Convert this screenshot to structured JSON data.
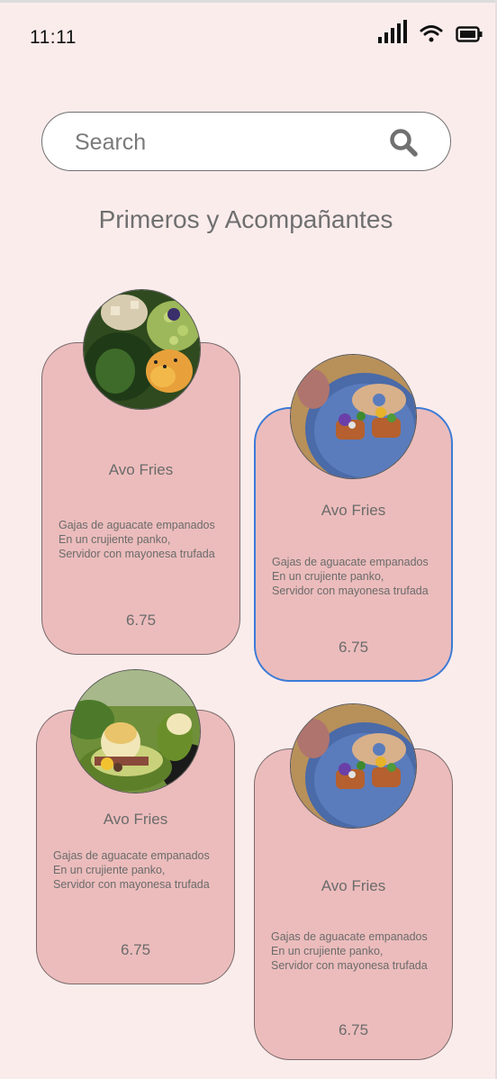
{
  "status": {
    "time": "11:11"
  },
  "search": {
    "placeholder": "Search"
  },
  "section": {
    "title": "Primeros y Acompañantes"
  },
  "cards": [
    {
      "name": "Avo Fries",
      "desc_line1": "Gajas de aguacate empanados",
      "desc_line2": "En un crujiente panko,",
      "desc_line3": "Servidor con mayonesa trufada",
      "price": "6.75",
      "photo": "salad-bowl-photo"
    },
    {
      "name": "Avo Fries",
      "desc_line1": "Gajas de aguacate empanados",
      "desc_line2": "En un crujiente panko,",
      "desc_line3": "Servidor con mayonesa trufada",
      "price": "6.75",
      "photo": "bagel-plate-photo"
    },
    {
      "name": "Avo Fries",
      "desc_line1": "Gajas de aguacate empanados",
      "desc_line2": "En un crujiente panko,",
      "desc_line3": "Servidor con mayonesa trufada",
      "price": "6.75",
      "photo": "avocado-egg-photo"
    },
    {
      "name": "Avo Fries",
      "desc_line1": "Gajas de aguacate empanados",
      "desc_line2": "En un crujiente panko,",
      "desc_line3": "Servidor con mayonesa trufada",
      "price": "6.75",
      "photo": "bagel-plate-photo"
    }
  ]
}
